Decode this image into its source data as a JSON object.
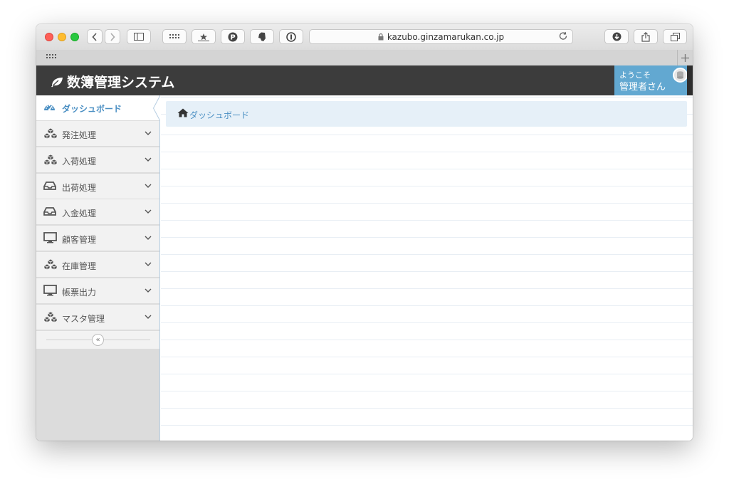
{
  "browser": {
    "url": "kazubo.ginzamarukan.co.jp"
  },
  "app": {
    "title": "数簿管理システム",
    "user_welcome": "ようこそ",
    "user_name": "管理者さん"
  },
  "sidebar": {
    "items": [
      {
        "label": "ダッシュボード",
        "icon": "dashboard-icon",
        "active": true
      },
      {
        "label": "発注処理",
        "icon": "cubes-icon"
      },
      {
        "label": "入荷処理",
        "icon": "cubes-icon"
      },
      {
        "label": "出荷処理",
        "icon": "inbox-icon"
      },
      {
        "label": "入金処理",
        "icon": "inbox-icon"
      },
      {
        "label": "顧客管理",
        "icon": "desktop-icon"
      },
      {
        "label": "在庫管理",
        "icon": "cubes-icon"
      },
      {
        "label": "帳票出力",
        "icon": "desktop-icon"
      },
      {
        "label": "マスタ管理",
        "icon": "cubes-icon"
      }
    ],
    "collapse_glyph": "«"
  },
  "breadcrumb": {
    "current": "ダッシュボード",
    "icon": "home-icon"
  },
  "colors": {
    "header_bg": "#3c3c3c",
    "accent": "#62a8d1",
    "link": "#4a8fc3"
  }
}
